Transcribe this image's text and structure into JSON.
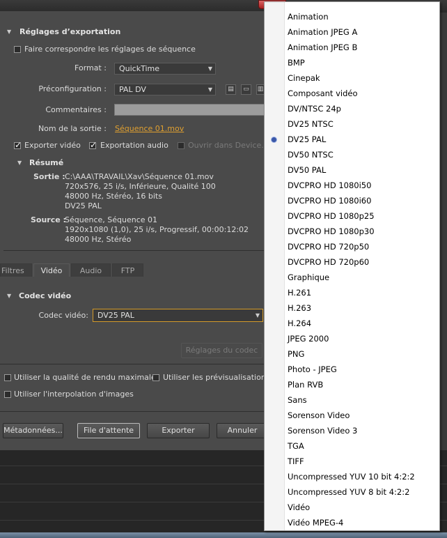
{
  "window": {
    "close_glyph": "x"
  },
  "export": {
    "title": "Réglages d’exportation",
    "match_sequence": "Faire correspondre les réglages de séquence",
    "format_label": "Format :",
    "format_value": "QuickTime",
    "preset_label": "Préconfiguration :",
    "preset_value": "PAL DV",
    "comments_label": "Commentaires :",
    "output_name_label": "Nom de la sortie :",
    "output_name_value": "Séquence 01.mov",
    "export_video": "Exporter vidéo",
    "export_audio": "Exportation audio",
    "open_device": "Ouvrir dans Device...",
    "summary_title": "Résumé",
    "output_key": "Sortie :",
    "output_lines": [
      "C:\\AAA\\TRAVAIL\\Xav\\Séquence 01.mov",
      "720x576, 25 i/s, Inférieure, Qualité  100",
      "48000 Hz, Stéréo, 16 bits",
      "DV25 PAL"
    ],
    "source_key": "Source :",
    "source_lines": [
      "Séquence, Séquence 01",
      "1920x1080 (1,0), 25 i/s, Progressif, 00:00:12:02",
      "48000 Hz, Stéréo"
    ]
  },
  "tabs": [
    "Filtres",
    "Vidéo",
    "Audio",
    "FTP"
  ],
  "codec": {
    "title": "Codec vidéo",
    "label": "Codec vidéo:",
    "value": "DV25 PAL",
    "settings_button": "Réglages du codec"
  },
  "options": {
    "max_render": "Utiliser la qualité de rendu maximale",
    "use_previews": "Utiliser les prévisualisations",
    "frame_blend": "Utiliser l'interpolation d'images"
  },
  "buttons": {
    "metadata": "Métadonnées...",
    "queue": "File d'attente",
    "export": "Exporter",
    "cancel": "Annuler"
  },
  "dropdown": {
    "selected": "DV25 PAL",
    "items": [
      "Animation",
      "Animation JPEG A",
      "Animation JPEG B",
      "BMP",
      "Cinepak",
      "Composant vidéo",
      "DV/NTSC 24p",
      "DV25 NTSC",
      "DV25 PAL",
      "DV50 NTSC",
      "DV50 PAL",
      "DVCPRO HD 1080i50",
      "DVCPRO HD 1080i60",
      "DVCPRO HD 1080p25",
      "DVCPRO HD 1080p30",
      "DVCPRO HD 720p50",
      "DVCPRO HD 720p60",
      "Graphique",
      "H.261",
      "H.263",
      "H.264",
      "JPEG 2000",
      "PNG",
      "Photo - JPEG",
      "Plan RVB",
      "Sans",
      "Sorenson Video",
      "Sorenson Video 3",
      "TGA",
      "TIFF",
      "Uncompressed YUV 10 bit 4:2:2",
      "Uncompressed YUV 8 bit 4:2:2",
      "Vidéo",
      "Vidéo MPEG-4"
    ]
  },
  "colors": {
    "panel": "#4a4a4a",
    "link": "#e0a030",
    "menu_bullet": "#3a57a8"
  }
}
